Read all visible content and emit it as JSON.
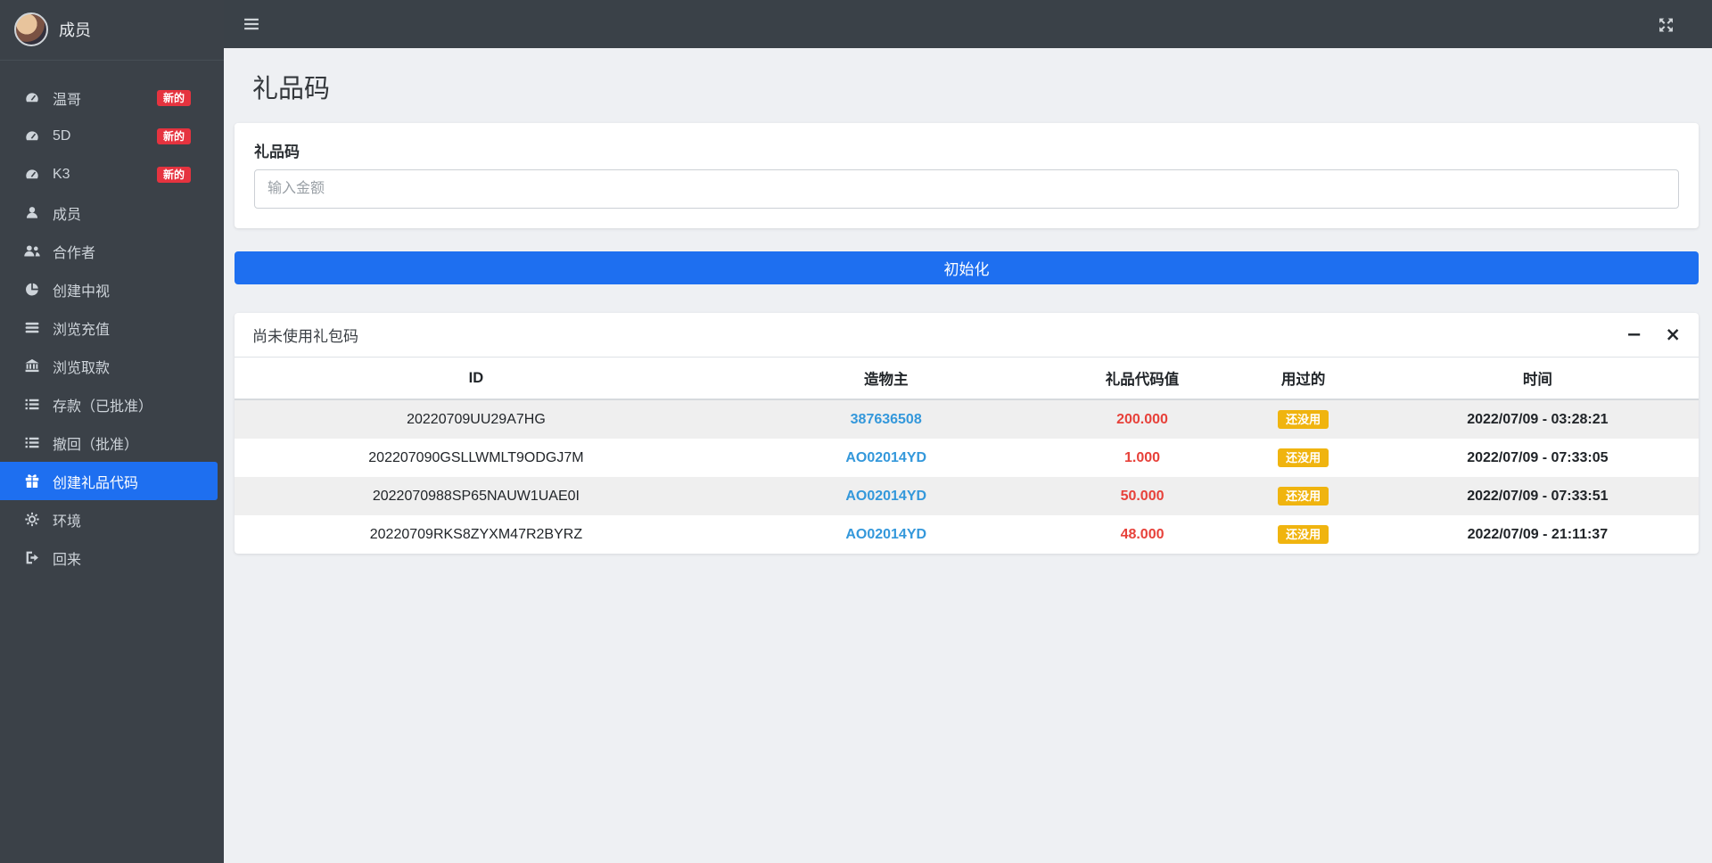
{
  "colors": {
    "primary": "#1e6ff0",
    "sidebar_bg": "#3b4148",
    "topbar_bg": "#3a4148",
    "content_bg": "#eef0f3",
    "badge_red": "#e5333f",
    "badge_yellow": "#f0b40f",
    "link_blue": "#3498db",
    "value_red": "#e7413a"
  },
  "sidebar": {
    "user_name": "成员",
    "items": [
      {
        "key": "wenge",
        "label": "温哥",
        "icon": "tachometer-icon",
        "badge": "新的"
      },
      {
        "key": "5d",
        "label": "5D",
        "icon": "tachometer-icon",
        "badge": "新的"
      },
      {
        "key": "k3",
        "label": "K3",
        "icon": "tachometer-icon",
        "badge": "新的"
      },
      {
        "key": "members",
        "label": "成员",
        "icon": "user-icon"
      },
      {
        "key": "partners",
        "label": "合作者",
        "icon": "users-icon"
      },
      {
        "key": "create-view",
        "label": "创建中视",
        "icon": "pie-chart-icon"
      },
      {
        "key": "browse-recharge",
        "label": "浏览充值",
        "icon": "money-stack-icon"
      },
      {
        "key": "browse-withdraw",
        "label": "浏览取款",
        "icon": "bank-icon"
      },
      {
        "key": "deposits-approved",
        "label": "存款（已批准）",
        "icon": "list-icon"
      },
      {
        "key": "withdraw-approved",
        "label": "撤回（批准）",
        "icon": "list-icon"
      },
      {
        "key": "create-gift-code",
        "label": "创建礼品代码",
        "icon": "gift-icon",
        "active": true
      },
      {
        "key": "environment",
        "label": "环境",
        "icon": "gear-icon"
      },
      {
        "key": "back",
        "label": "回来",
        "icon": "sign-out-icon"
      }
    ]
  },
  "page": {
    "title": "礼品码"
  },
  "form_card": {
    "label": "礼品码",
    "input_placeholder": "输入金额",
    "submit_label": "初始化"
  },
  "table_card": {
    "title": "尚未使用礼包码",
    "minimize_glyph": "−",
    "close_glyph": "×",
    "columns": [
      "ID",
      "造物主",
      "礼品代码值",
      "用过的",
      "时间"
    ],
    "rows": [
      [
        "20220709UU29A7HG",
        "387636508",
        "200.000",
        "还没用",
        "2022/07/09 - 03:28:21"
      ],
      [
        "202207090GSLLWMLT9ODGJ7M",
        "AO02014YD",
        "1.000",
        "还没用",
        "2022/07/09 - 07:33:05"
      ],
      [
        "2022070988SP65NAUW1UAE0I",
        "AO02014YD",
        "50.000",
        "还没用",
        "2022/07/09 - 07:33:51"
      ],
      [
        "20220709RKS8ZYXM47R2BYRZ",
        "AO02014YD",
        "48.000",
        "还没用",
        "2022/07/09 - 21:11:37"
      ]
    ]
  }
}
